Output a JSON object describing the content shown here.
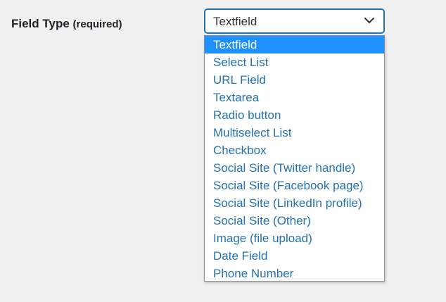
{
  "field": {
    "label": "Field Type",
    "required_note": "(required)"
  },
  "select": {
    "value": "Textfield",
    "arrow_icon": "chevron-down-icon"
  },
  "options": [
    "Textfield",
    "Select List",
    "URL Field",
    "Textarea",
    "Radio button",
    "Multiselect List",
    "Checkbox",
    "Social Site (Twitter handle)",
    "Social Site (Facebook page)",
    "Social Site (LinkedIn profile)",
    "Social Site (Other)",
    "Image (file upload)",
    "Date Field",
    "Phone Number"
  ],
  "selected_index": 0,
  "colors": {
    "background": "#f0f0f1",
    "accent": "#2271b1",
    "highlight": "#1e90ff",
    "label_text": "#1d2327"
  }
}
